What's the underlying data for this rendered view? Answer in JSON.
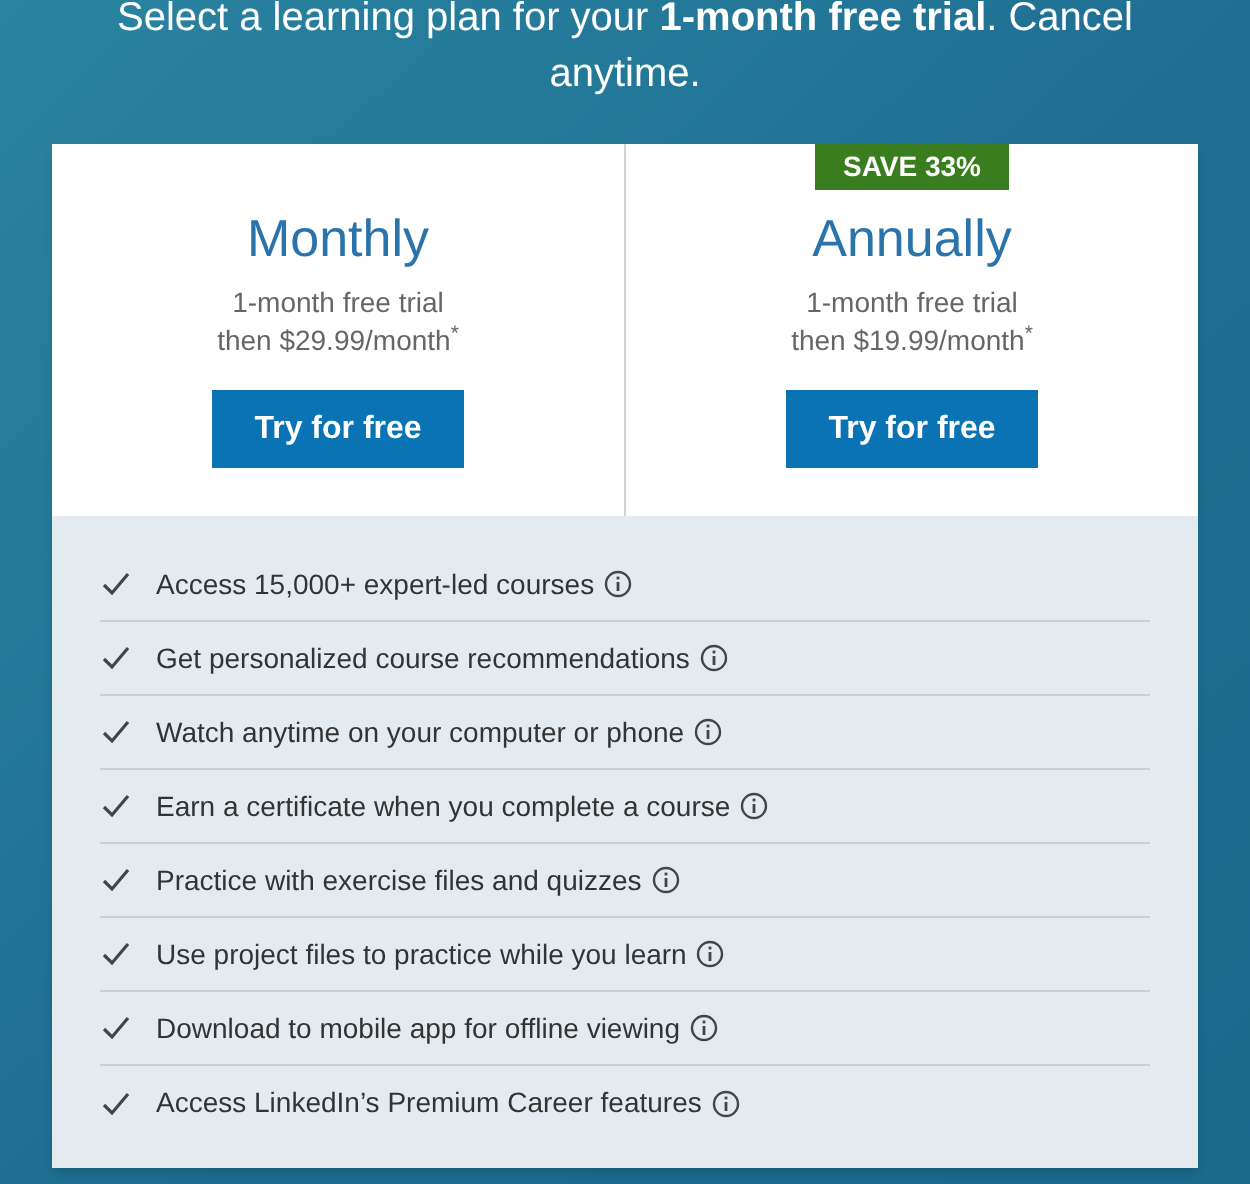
{
  "heading": "Select a learning plan for your **1-month free trial**. Cancel anytime.",
  "plans": [
    {
      "name": "Monthly",
      "trial": "1-month free trial",
      "price": "then $29.99/month$^{*}$",
      "button": "Try for free"
    },
    {
      "name": "Annually",
      "badge": "SAVE 33%",
      "trial": "1-month free trial",
      "price": "then $19.99/month$^{*}$",
      "button": "Try for free"
    }
  ],
  "features": [
    {
      "text": "Access 15,000+ expert-led courses"
    },
    {
      "text": "Get personalized course recommendations"
    },
    {
      "text": "Watch anytime on your computer or phone"
    },
    {
      "text": "Earn a certificate when you complete a course"
    },
    {
      "text": "Practice with exercise files and quizzes"
    },
    {
      "text": "Use project files to practice while you learn"
    },
    {
      "text": "Download to mobile app for offline viewing"
    },
    {
      "text": "Access LinkedIn’s Premium Career features"
    }
  ]
}
